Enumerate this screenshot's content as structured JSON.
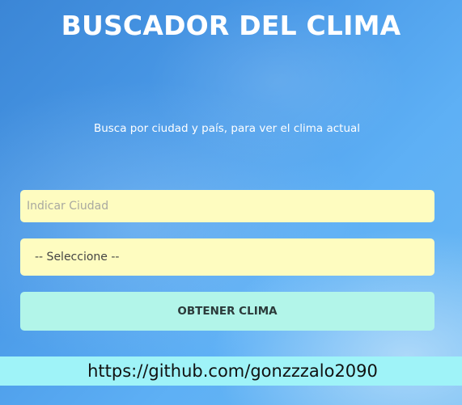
{
  "header": {
    "title": "BUSCADOR DEL CLIMA",
    "subtitle": "Busca por ciudad y país, para ver el clima actual"
  },
  "form": {
    "city_placeholder": "Indicar Ciudad",
    "city_value": "",
    "country_selected": "-- Seleccione --",
    "submit_label": "OBTENER CLIMA"
  },
  "footer": {
    "link_text": "https://github.com/gonzzzalo2090"
  },
  "colors": {
    "input_background": "#fefcc0",
    "button_background": "#b2f5e9",
    "footer_background": "#9ff3f8",
    "text_light": "#ffffff"
  }
}
